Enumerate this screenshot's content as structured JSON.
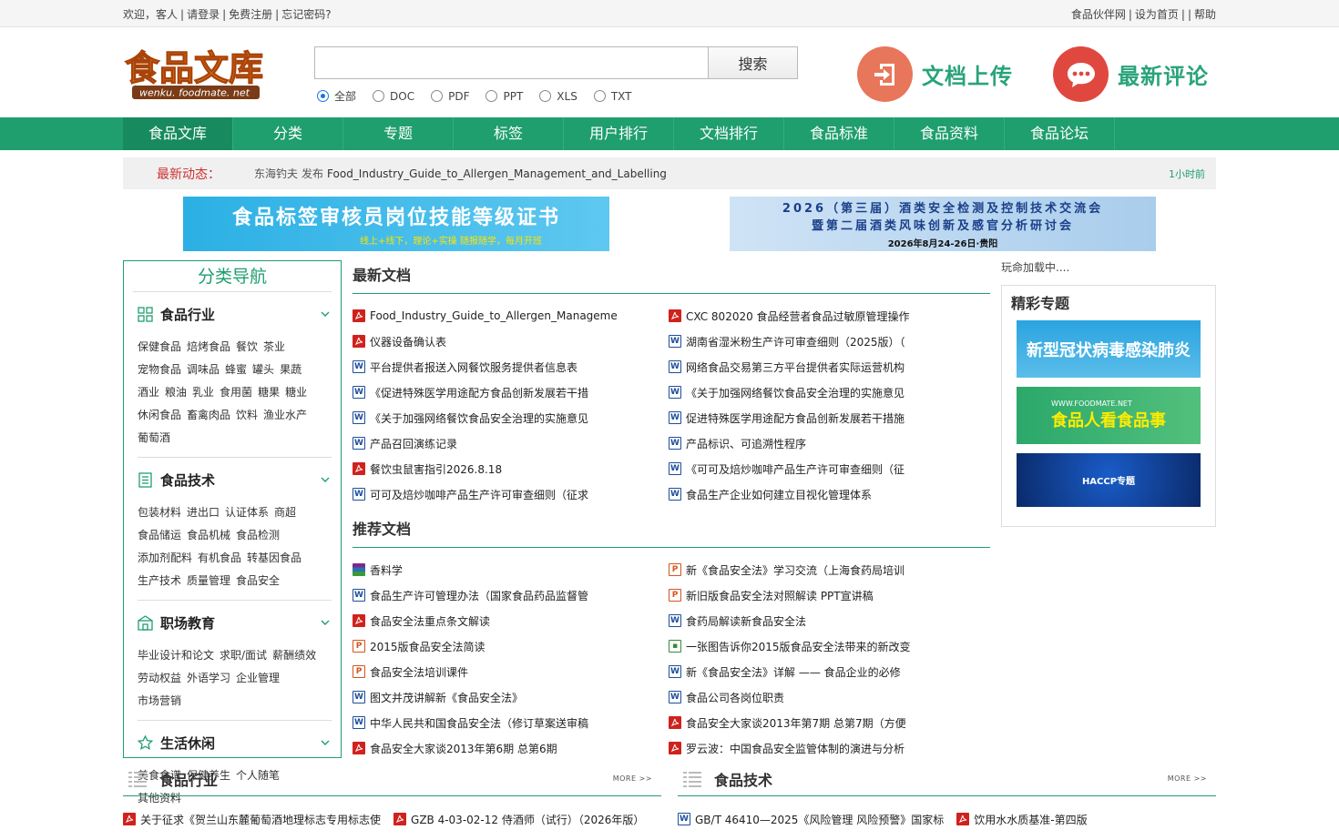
{
  "topbar": {
    "welcome": "欢迎，",
    "guest": "客人",
    "login": "请登录",
    "register": "免费注册",
    "forgot": "忘记密码?",
    "partner": "食品伙伴网",
    "set_home": "设为首页",
    "help": "帮助"
  },
  "logo": {
    "main": "食品文库",
    "sub": "wenku. foodmate. net"
  },
  "search": {
    "value": "",
    "placeholder": "",
    "button": "搜索",
    "types": [
      "全部",
      "DOC",
      "PDF",
      "PPT",
      "XLS",
      "TXT"
    ],
    "selected": "全部"
  },
  "promos": {
    "upload": "文档上传",
    "comments": "最新评论"
  },
  "nav": [
    "食品文库",
    "分类",
    "专题",
    "标签",
    "用户排行",
    "文档排行",
    "食品标准",
    "食品资料",
    "食品论坛"
  ],
  "news": {
    "title": "最新动态：",
    "user": "东海钓夫",
    "action": "发布",
    "doc": "Food_Industry_Guide_to_Allergen_Management_and_Labelling",
    "time": "1小时前"
  },
  "banners": {
    "b1_big": "食品标签审核员岗位技能等级证书",
    "b1_small": "线上+线下，理论+实操  随报随学，每月开班",
    "b2_l1": "2026（第三届）酒类安全检测及控制技术交流会",
    "b2_l2": "暨第二届酒类风味创新及感官分析研讨会",
    "b2_l3": "2026年8月24-26日·贵阳"
  },
  "sidebar": {
    "title": "分类导航",
    "cats": [
      {
        "name": "食品行业",
        "icon": "grid-icon",
        "links": [
          "保健食品",
          "焙烤食品",
          "餐饮",
          "茶业",
          "宠物食品",
          "调味品",
          "蜂蜜",
          "罐头",
          "果蔬",
          "酒业",
          "粮油",
          "乳业",
          "食用菌",
          "糖果",
          "糖业",
          "休闲食品",
          "畜禽肉品",
          "饮料",
          "渔业水产",
          "葡萄酒"
        ]
      },
      {
        "name": "食品技术",
        "icon": "document-icon",
        "links": [
          "包装材料",
          "进出口",
          "认证体系",
          "商超",
          "食品储运",
          "食品机械",
          "食品检测",
          "添加剂配料",
          "有机食品",
          "转基因食品",
          "生产技术",
          "质量管理",
          "食品安全"
        ]
      },
      {
        "name": "职场教育",
        "icon": "building-icon",
        "links": [
          "毕业设计和论文",
          "求职/面试",
          "薪酬绩效",
          "劳动权益",
          "外语学习",
          "企业管理",
          "市场营销"
        ]
      },
      {
        "name": "生活休闲",
        "icon": "star-icon",
        "links": [
          "美食食谱",
          "保健养生",
          "个人随笔",
          "其他资料"
        ]
      }
    ]
  },
  "latest": {
    "title": "最新文档",
    "items": [
      {
        "type": "pdf",
        "text": "Food_Industry_Guide_to_Allergen_Manageme"
      },
      {
        "type": "pdf",
        "text": "CXC 802020 食品经营者食品过敏原管理操作"
      },
      {
        "type": "pdf",
        "text": "仪器设备确认表"
      },
      {
        "type": "doc",
        "text": "湖南省湿米粉生产许可审查细则（2025版）（"
      },
      {
        "type": "doc",
        "text": "平台提供者报送入网餐饮服务提供者信息表"
      },
      {
        "type": "doc",
        "text": "网络食品交易第三方平台提供者实际运营机构"
      },
      {
        "type": "doc",
        "text": "《促进特殊医学用途配方食品创新发展若干措"
      },
      {
        "type": "doc",
        "text": "《关于加强网络餐饮食品安全治理的实施意见"
      },
      {
        "type": "doc",
        "text": "《关于加强网络餐饮食品安全治理的实施意见"
      },
      {
        "type": "doc",
        "text": "促进特殊医学用途配方食品创新发展若干措施"
      },
      {
        "type": "doc",
        "text": "产品召回演练记录"
      },
      {
        "type": "doc",
        "text": "产品标识、可追溯性程序"
      },
      {
        "type": "pdf",
        "text": "餐饮虫鼠害指引2026.8.18"
      },
      {
        "type": "doc",
        "text": "《可可及焙炒咖啡产品生产许可审查细则（征"
      },
      {
        "type": "doc",
        "text": "可可及焙炒咖啡产品生产许可审查细则（征求"
      },
      {
        "type": "doc",
        "text": "食品生产企业如何建立目视化管理体系"
      }
    ]
  },
  "recommended": {
    "title": "推荐文档",
    "items": [
      {
        "type": "rar",
        "text": "香料学"
      },
      {
        "type": "ppt",
        "text": "新《食品安全法》学习交流（上海食药局培训"
      },
      {
        "type": "doc",
        "text": "食品生产许可管理办法（国家食品药品监督管"
      },
      {
        "type": "ppt",
        "text": "新旧版食品安全法对照解读 PPT宣讲稿"
      },
      {
        "type": "pdf",
        "text": "食品安全法重点条文解读"
      },
      {
        "type": "doc",
        "text": "食药局解读新食品安全法"
      },
      {
        "type": "ppt",
        "text": "2015版食品安全法简读"
      },
      {
        "type": "img",
        "text": "一张图告诉你2015版食品安全法带来的新改变"
      },
      {
        "type": "ppt",
        "text": "食品安全法培训课件"
      },
      {
        "type": "doc",
        "text": "新《食品安全法》详解 —— 食品企业的必修"
      },
      {
        "type": "doc",
        "text": "图文并茂讲解新《食品安全法》"
      },
      {
        "type": "doc",
        "text": "食品公司各岗位职责"
      },
      {
        "type": "doc",
        "text": "中华人民共和国食品安全法（修订草案送审稿"
      },
      {
        "type": "pdf",
        "text": "食品安全大家谈2013年第7期 总第7期（方便"
      },
      {
        "type": "pdf",
        "text": "食品安全大家谈2013年第6期 总第6期"
      },
      {
        "type": "pdf",
        "text": "罗云波：中国食品安全监管体制的演进与分析"
      }
    ]
  },
  "right": {
    "loading": "玩命加载中....",
    "topics_title": "精彩专题",
    "topics": [
      "新型冠状病毒感染肺炎",
      "食品人看食品事",
      "HACCP专题"
    ],
    "topic2_url": "WWW.FOODMATE.NET"
  },
  "bottom": {
    "more": "MORE >>",
    "industry": {
      "title": "食品行业",
      "items": [
        {
          "type": "pdf",
          "text": "关于征求《贺兰山东麓葡萄酒地理标志专用标志使"
        },
        {
          "type": "pdf",
          "text": "GZB 4-03-02-12 侍酒师（试行）（2026年版）"
        }
      ]
    },
    "tech": {
      "title": "食品技术",
      "items": [
        {
          "type": "doc",
          "text": "GB/T 46410—2025《风险管理 风险预警》国家标"
        },
        {
          "type": "pdf",
          "text": "饮用水水质基准-第四版"
        }
      ]
    }
  },
  "colors": {
    "brand": "#1f9e6e",
    "accent_red": "#d03030",
    "upload_circle": "#e8765a",
    "comment_circle": "#e0483f"
  }
}
